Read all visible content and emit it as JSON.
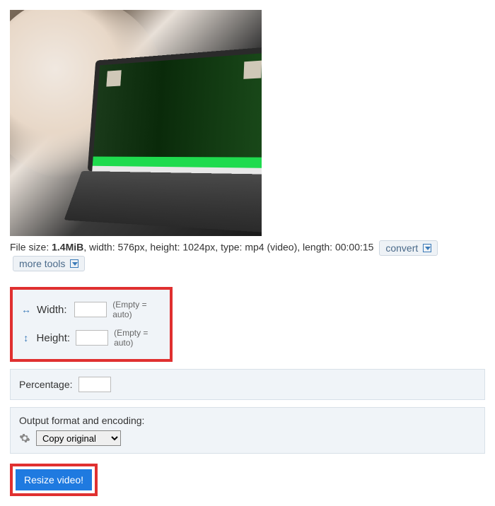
{
  "preview": {
    "alt": "Video thumbnail showing a person with a laptop"
  },
  "info": {
    "filesize_label": "File size: ",
    "filesize_value": "1.4MiB",
    "width_label": ", width: ",
    "width_value": "576px",
    "height_label": ", height: ",
    "height_value": "1024px",
    "type_label": ", type: ",
    "type_value": "mp4 (video)",
    "length_label": ", length: ",
    "length_value": "00:00:15"
  },
  "actions": {
    "convert_label": "convert",
    "moretools_label": "more tools"
  },
  "dimensions": {
    "width_label": "Width:",
    "height_label": "Height:",
    "width_value": "",
    "height_value": "",
    "hint": "(Empty = auto)"
  },
  "percentage": {
    "label": "Percentage:",
    "value": ""
  },
  "output": {
    "label": "Output format and encoding:",
    "selected": "Copy original"
  },
  "submit": {
    "label": "Resize video!"
  }
}
